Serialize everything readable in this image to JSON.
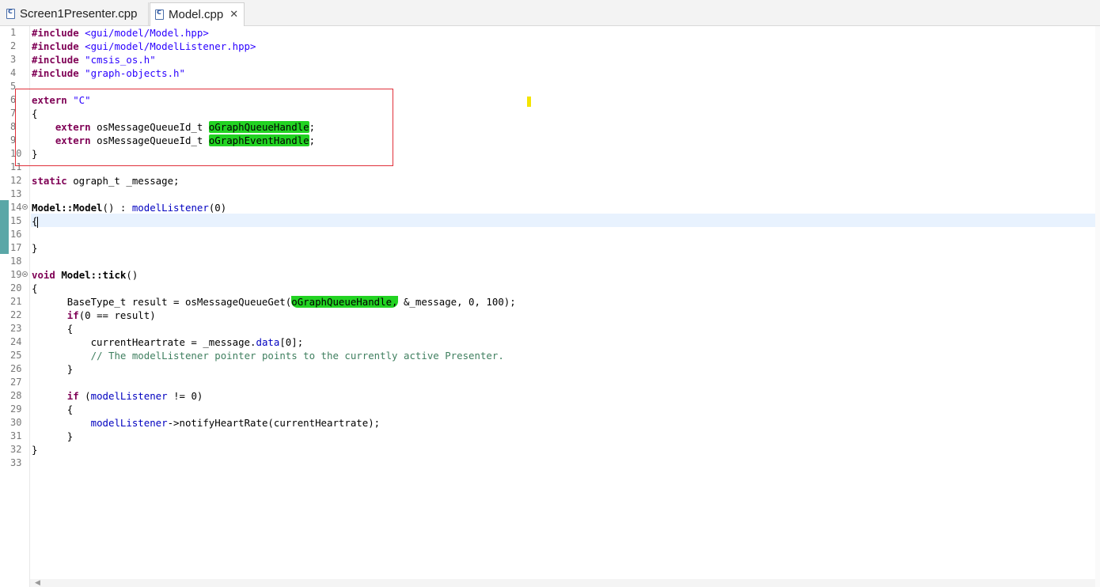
{
  "tabs": [
    {
      "label": "Screen1Presenter.cpp",
      "icon": "cpp-file-icon",
      "active": false
    },
    {
      "label": "Model.cpp",
      "icon": "cpp-file-icon",
      "active": true,
      "close": "✕"
    }
  ],
  "lines": [
    {
      "n": "1",
      "segs": [
        [
          "kw2",
          "#include "
        ],
        [
          "inc",
          "<gui/model/Model.hpp>"
        ]
      ]
    },
    {
      "n": "2",
      "segs": [
        [
          "kw2",
          "#include "
        ],
        [
          "inc",
          "<gui/model/ModelListener.hpp>"
        ]
      ]
    },
    {
      "n": "3",
      "segs": [
        [
          "kw2",
          "#include "
        ],
        [
          "str",
          "\"cmsis_os.h\""
        ]
      ]
    },
    {
      "n": "4",
      "segs": [
        [
          "kw2",
          "#include "
        ],
        [
          "str",
          "\"graph-objects.h\""
        ]
      ]
    },
    {
      "n": "5",
      "segs": []
    },
    {
      "n": "6",
      "segs": [
        [
          "kw",
          "extern "
        ],
        [
          "str",
          "\"C\""
        ]
      ]
    },
    {
      "n": "7",
      "segs": [
        [
          "",
          "{"
        ]
      ]
    },
    {
      "n": "8",
      "segs": [
        [
          "",
          "    "
        ],
        [
          "kw",
          "extern "
        ],
        [
          "",
          "osMessageQueueId_t "
        ],
        [
          "hl",
          "oGraphQueueHandle"
        ],
        [
          "",
          ";"
        ]
      ]
    },
    {
      "n": "9",
      "segs": [
        [
          "",
          "    "
        ],
        [
          "kw",
          "extern "
        ],
        [
          "",
          "osMessageQueueId_t "
        ],
        [
          "hl",
          "oGraphEventHandle"
        ],
        [
          "",
          ";"
        ]
      ]
    },
    {
      "n": "10",
      "segs": [
        [
          "",
          "}"
        ]
      ]
    },
    {
      "n": "11",
      "segs": []
    },
    {
      "n": "12",
      "segs": [
        [
          "kw",
          "static "
        ],
        [
          "",
          "ograph_t _message;"
        ]
      ]
    },
    {
      "n": "13",
      "segs": []
    },
    {
      "n": "14",
      "fold": true,
      "segs": [
        [
          "bold",
          "Model::Model"
        ],
        [
          "",
          "() : "
        ],
        [
          "field",
          "modelListener"
        ],
        [
          "",
          "(0)"
        ]
      ]
    },
    {
      "n": "15",
      "cursor": true,
      "segs": [
        [
          "",
          "{"
        ]
      ]
    },
    {
      "n": "16",
      "segs": []
    },
    {
      "n": "17",
      "segs": [
        [
          "",
          "}"
        ]
      ]
    },
    {
      "n": "18",
      "segs": []
    },
    {
      "n": "19",
      "fold": true,
      "segs": [
        [
          "kw",
          "void "
        ],
        [
          "bold",
          "Model::tick"
        ],
        [
          "",
          "()"
        ]
      ]
    },
    {
      "n": "20",
      "segs": [
        [
          "",
          "{"
        ]
      ]
    },
    {
      "n": "21",
      "segs": [
        [
          "",
          "      BaseType_t result = osMessageQueueGet("
        ],
        [
          "hl2",
          "oGraphQueueHandle,"
        ],
        [
          "",
          " &_message, 0, 100);"
        ]
      ]
    },
    {
      "n": "22",
      "segs": [
        [
          "",
          "      "
        ],
        [
          "kw",
          "if"
        ],
        [
          "",
          "(0 == result)"
        ]
      ]
    },
    {
      "n": "23",
      "segs": [
        [
          "",
          "      {"
        ]
      ]
    },
    {
      "n": "24",
      "segs": [
        [
          "",
          "          currentHeartrate = _message."
        ],
        [
          "field",
          "data"
        ],
        [
          "",
          "[0];"
        ]
      ]
    },
    {
      "n": "25",
      "segs": [
        [
          "",
          "          "
        ],
        [
          "cmt",
          "// The modelListener pointer points to the currently active Presenter."
        ]
      ]
    },
    {
      "n": "26",
      "segs": [
        [
          "",
          "      }"
        ]
      ]
    },
    {
      "n": "27",
      "segs": []
    },
    {
      "n": "28",
      "segs": [
        [
          "",
          "      "
        ],
        [
          "kw",
          "if "
        ],
        [
          "",
          "("
        ],
        [
          "field",
          "modelListener"
        ],
        [
          "",
          " != 0)"
        ]
      ]
    },
    {
      "n": "29",
      "segs": [
        [
          "",
          "      {"
        ]
      ]
    },
    {
      "n": "30",
      "segs": [
        [
          "",
          "          "
        ],
        [
          "field",
          "modelListener"
        ],
        [
          "",
          "->notifyHeartRate(currentHeartrate);"
        ]
      ]
    },
    {
      "n": "31",
      "segs": [
        [
          "",
          "      }"
        ]
      ]
    },
    {
      "n": "32",
      "segs": [
        [
          "",
          "}"
        ]
      ]
    },
    {
      "n": "33",
      "segs": []
    }
  ],
  "colors": {
    "keyword": "#7f0055",
    "string": "#2a00ff",
    "field": "#0000c0",
    "comment": "#3f7f5f",
    "highlight": "#22d322",
    "annotation_box": "#e0303a",
    "marker": "#f4e400",
    "change_bar": "#5aa7a7"
  }
}
